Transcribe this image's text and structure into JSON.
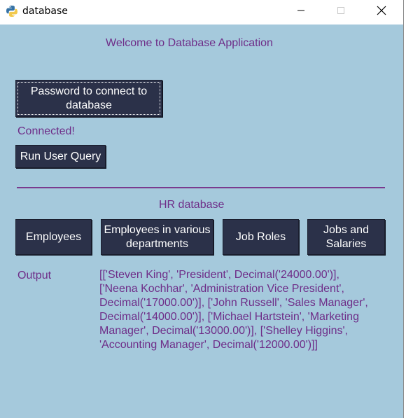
{
  "window": {
    "title": "database"
  },
  "icons": {
    "app": "python-icon",
    "minimize": "minimize-icon",
    "maximize": "maximize-icon",
    "close": "close-icon"
  },
  "colors": {
    "background": "#a5c9dc",
    "label_text": "#6e2d88",
    "button_bg": "#2b3149",
    "button_text": "#ffffff",
    "divider": "#7a3a8e"
  },
  "main": {
    "welcome": "Welcome to Database Application",
    "connect_button": "Password to connect to\ndatabase",
    "status": "Connected!",
    "run_query_button": "Run User Query",
    "section_title": "HR database",
    "buttons": {
      "employees": "Employees",
      "employees_departments": "Employees in various\ndepartments",
      "job_roles": "Job Roles",
      "jobs_salaries": "Jobs and\nSalaries"
    },
    "output_label": "Output",
    "output_text": "[['Steven King', 'President', Decimal('24000.00')],\n['Neena Kochhar', 'Administration Vice President',\nDecimal('17000.00')], ['John Russell', 'Sales Manager',\nDecimal('14000.00')], ['Michael Hartstein', 'Marketing\nManager', Decimal('13000.00')], ['Shelley Higgins',\n'Accounting Manager', Decimal('12000.00')]]"
  }
}
